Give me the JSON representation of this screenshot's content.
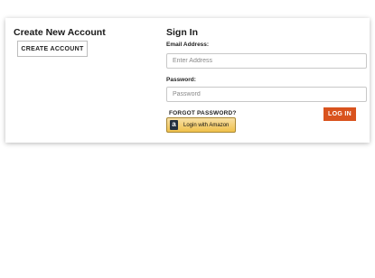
{
  "create_account": {
    "title": "Create New Account",
    "button_label": "CREATE ACCOUNT"
  },
  "sign_in": {
    "title": "Sign In",
    "email_label": "Email Address:",
    "email_placeholder": "Enter Address",
    "email_value": "",
    "password_label": "Password:",
    "password_placeholder": "Password",
    "password_value": "",
    "forgot_password_label": "FORGOT PASSWORD?",
    "amazon_icon": "amazon-a-icon",
    "amazon_icon_glyph": "a",
    "amazon_login_label": "Login with Amazon",
    "login_button_label": "LOG IN"
  },
  "colors": {
    "login_button": "#d9531e",
    "amazon_button": "#f0c14b",
    "amazon_icon_bg": "#232f3e"
  }
}
